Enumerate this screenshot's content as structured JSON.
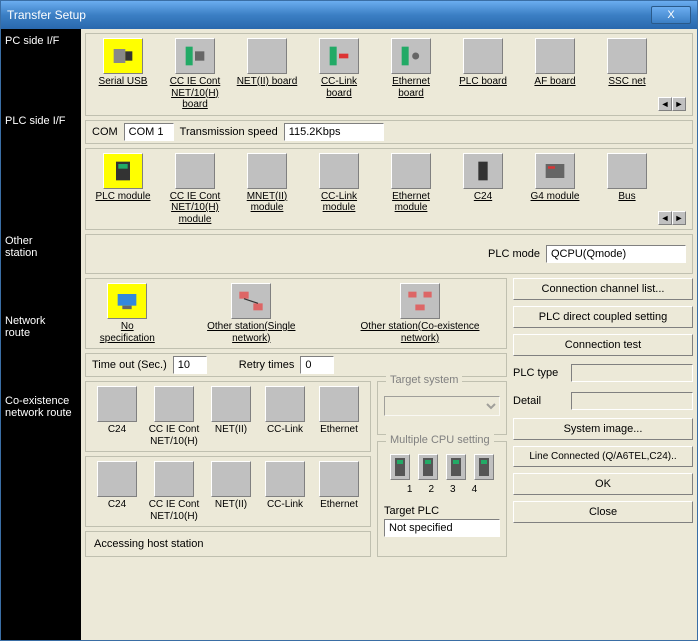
{
  "title": "Transfer Setup",
  "close_x": "X",
  "sidebar": {
    "pc": "PC side I/F",
    "plc": "PLC side I/F",
    "other": "Other\nstation",
    "net": "Network\nroute",
    "coex": "Co-existence\nnetwork route"
  },
  "pc_row": {
    "items": [
      "Serial USB",
      "CC IE Cont NET/10(H) board",
      "NET(II) board",
      "CC-Link board",
      "Ethernet board",
      "PLC board",
      "AF board",
      "SSC net"
    ]
  },
  "com_row": {
    "com_label": "COM",
    "com_value": "COM 1",
    "speed_label": "Transmission speed",
    "speed_value": "115.2Kbps"
  },
  "plc_row": {
    "items": [
      "PLC module",
      "CC IE Cont NET/10(H) module",
      "MNET(II) module",
      "CC-Link module",
      "Ethernet module",
      "C24",
      "G4 module",
      "Bus"
    ]
  },
  "plc_mode": {
    "label": "PLC mode",
    "value": "QCPU(Qmode)"
  },
  "other_row": {
    "items": [
      "No specification",
      "Other station(Single network)",
      "Other station(Co-existence network)"
    ]
  },
  "timeout": {
    "label": "Time out (Sec.)",
    "value": "10",
    "retry_label": "Retry times",
    "retry_value": "0"
  },
  "net_route": {
    "items": [
      "C24",
      "CC IE Cont NET/10(H)",
      "NET(II)",
      "CC-Link",
      "Ethernet"
    ]
  },
  "coex_route": {
    "items": [
      "C24",
      "CC IE Cont NET/10(H)",
      "NET(II)",
      "CC-Link",
      "Ethernet"
    ]
  },
  "target_system": {
    "title": "Target system"
  },
  "multi_cpu": {
    "title": "Multiple CPU setting",
    "nums": [
      "1",
      "2",
      "3",
      "4"
    ],
    "target_plc_label": "Target PLC",
    "target_plc_value": "Not specified"
  },
  "right_buttons": {
    "chan_list": "Connection  channel list...",
    "direct": "PLC direct coupled setting",
    "test": "Connection test",
    "plc_type_label": "PLC type",
    "detail_label": "Detail",
    "sys_image": "System  image...",
    "line_conn": "Line Connected (Q/A6TEL,C24)..",
    "ok": "OK",
    "close": "Close"
  },
  "status_text": "Accessing host station"
}
